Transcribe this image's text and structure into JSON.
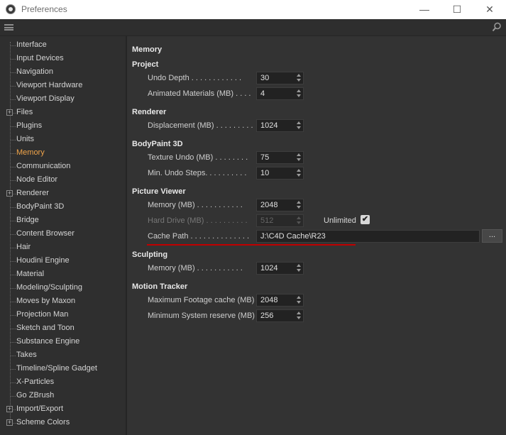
{
  "window": {
    "title": "Preferences",
    "minimize": "—",
    "maximize": "☐",
    "close": "✕"
  },
  "sidebar": {
    "items": [
      {
        "label": "Interface"
      },
      {
        "label": "Input Devices"
      },
      {
        "label": "Navigation"
      },
      {
        "label": "Viewport Hardware"
      },
      {
        "label": "Viewport Display"
      },
      {
        "label": "Files",
        "expandable": true
      },
      {
        "label": "Plugins"
      },
      {
        "label": "Units"
      },
      {
        "label": "Memory",
        "active": true
      },
      {
        "label": "Communication"
      },
      {
        "label": "Node Editor"
      },
      {
        "label": "Renderer",
        "expandable": true
      },
      {
        "label": "BodyPaint 3D"
      },
      {
        "label": "Bridge"
      },
      {
        "label": "Content Browser"
      },
      {
        "label": "Hair"
      },
      {
        "label": "Houdini Engine"
      },
      {
        "label": "Material"
      },
      {
        "label": "Modeling/Sculpting"
      },
      {
        "label": "Moves by Maxon"
      },
      {
        "label": "Projection Man"
      },
      {
        "label": "Sketch and Toon"
      },
      {
        "label": "Substance Engine"
      },
      {
        "label": "Takes"
      },
      {
        "label": "Timeline/Spline Gadget"
      },
      {
        "label": "X-Particles"
      },
      {
        "label": "Go ZBrush"
      },
      {
        "label": "Import/Export",
        "expandable": true
      },
      {
        "label": "Scheme Colors",
        "expandable": true
      }
    ]
  },
  "memory": {
    "heading": "Memory",
    "project": {
      "title": "Project",
      "undo_depth_label": "Undo Depth . . . . . . . . . . . .",
      "undo_depth": "30",
      "anim_mat_label": "Animated Materials (MB) . . . .",
      "anim_mat": "4"
    },
    "renderer": {
      "title": "Renderer",
      "displacement_label": "Displacement (MB) . . . . . . . . .",
      "displacement": "1024"
    },
    "bodypaint": {
      "title": "BodyPaint 3D",
      "texture_undo_label": "Texture Undo (MB) . . . . . . . .",
      "texture_undo": "75",
      "min_undo_label": "Min. Undo Steps. . . . . . . . . .",
      "min_undo": "10"
    },
    "picture_viewer": {
      "title": "Picture Viewer",
      "memory_label": "Memory (MB) . . . . . . . . . . .",
      "memory": "2048",
      "hard_drive_label": "Hard Drive (MB) . . . . . . . . . .",
      "hard_drive": "512",
      "unlimited_label": "Unlimited",
      "unlimited_checked": true,
      "cache_path_label": "Cache Path . . . . . . . . . . . . . .",
      "cache_path": "J:\\C4D Cache\\R23",
      "browse_label": "..."
    },
    "sculpting": {
      "title": "Sculpting",
      "memory_label": "Memory (MB) . . . . . . . . . . .",
      "memory": "1024"
    },
    "motion_tracker": {
      "title": "Motion Tracker",
      "max_footage_label": "Maximum Footage cache (MB)",
      "max_footage": "2048",
      "min_reserve_label": "Minimum System reserve (MB)",
      "min_reserve": "256"
    }
  },
  "colors": {
    "accent": "#f0a44a",
    "underline": "#c00000"
  }
}
